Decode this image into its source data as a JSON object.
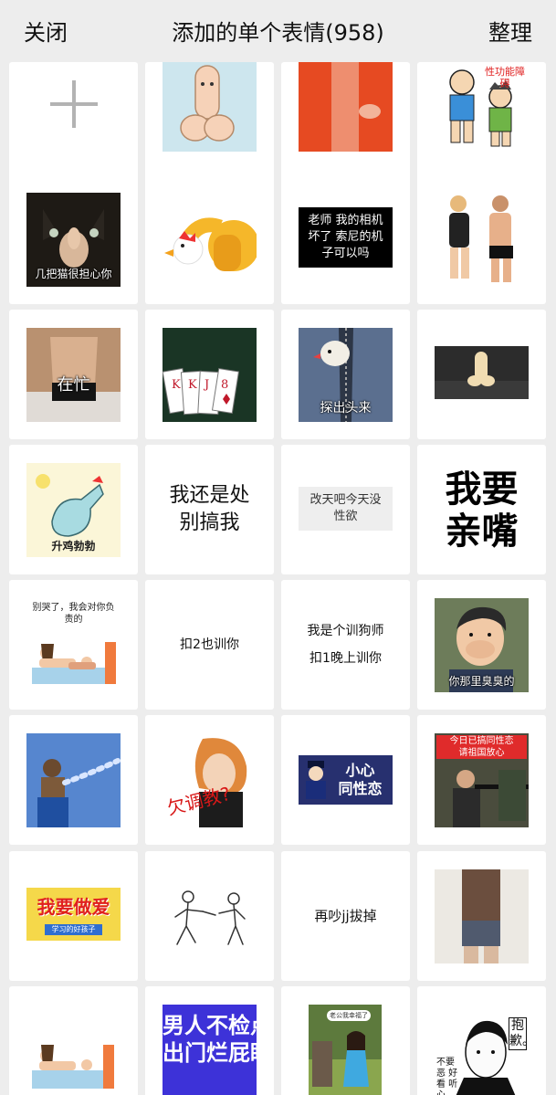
{
  "nav": {
    "close_label": "关闭",
    "title": "添加的单个表情(958)",
    "organize_label": "整理"
  },
  "stickers": {
    "add_symbol": "+",
    "s1_caption": "性功能障碍",
    "s2_caption": "几把猫很担心你",
    "s3_caption": "老师 我的相机\n坏了 索尼的机\n子可以吗",
    "s4_caption": "在忙",
    "s5_caption": "探出头来",
    "s6_caption": "升鸡勃勃",
    "s7_caption": "我还是处\n别搞我",
    "s8_caption": "改天吧今天没\n性欲",
    "s9_caption": "我要\n亲嘴",
    "s10_caption": "别哭了，我会对你负\n责的",
    "s11_caption": "扣2也训你",
    "s12_caption": "我是个训狗师\n扣1晚上训你",
    "s13_caption": "你那里臭臭的",
    "s14_caption": "欠调教?",
    "s15_caption": "小心\n同性恋",
    "s16_caption": "今日已搞同性恋\n请祖国放心",
    "s17_caption": "我要做爱",
    "s17_sub": "学习的好孩子",
    "s18_caption": "再吵jj拔掉",
    "s19_caption": "男人不检点\n出门烂屁眼",
    "s20_caption": "老公我幸福了",
    "s21_caption": "抱歉。",
    "s21_caption2": "不要恶 好看 听 心"
  }
}
